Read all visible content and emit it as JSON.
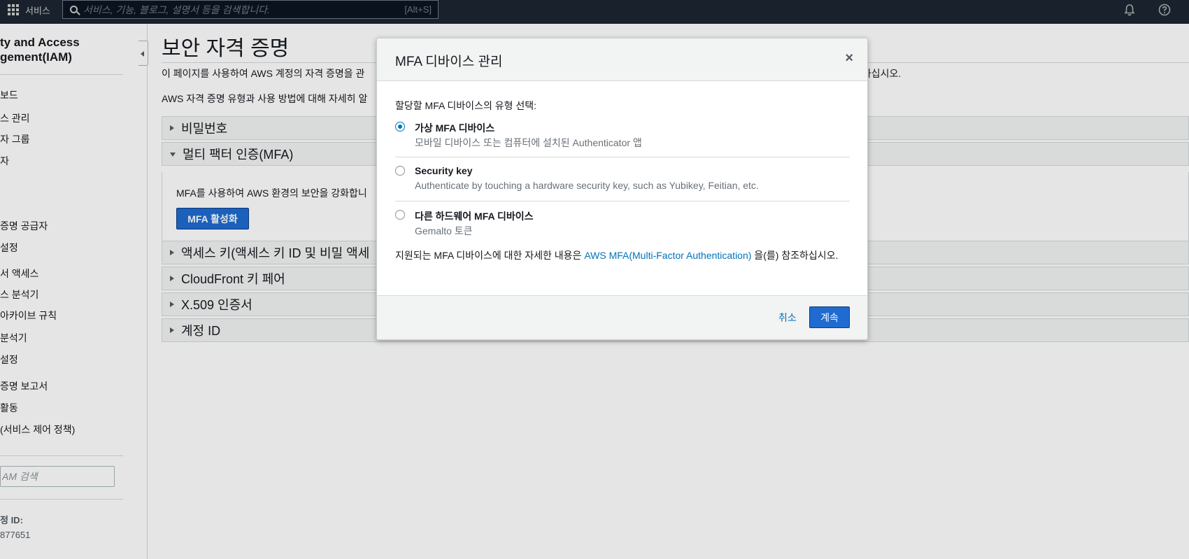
{
  "header": {
    "services_label": "서비스",
    "search_placeholder": "서비스, 기능, 블로그, 설명서 등을 검색합니다.",
    "search_shortcut": "[Alt+S]"
  },
  "sidebar": {
    "title_line1": "ty and Access",
    "title_line2": "gement(IAM)",
    "items": [
      {
        "label": "보드"
      },
      {
        "label": "스 관리"
      },
      {
        "label": "자 그룹"
      },
      {
        "label": "자"
      },
      {
        "label": ""
      },
      {
        "label": ""
      },
      {
        "label": "증명 공급자"
      },
      {
        "label": "설정"
      },
      {
        "label": "서 액세스"
      },
      {
        "label": "스 분석기"
      },
      {
        "label": "아카이브 규칙"
      },
      {
        "label": "분석기"
      },
      {
        "label": "설정"
      },
      {
        "label": "증명 보고서"
      },
      {
        "label": "활동"
      },
      {
        "label": "(서비스 제어 정책)"
      }
    ],
    "search_placeholder": "AM 검색",
    "account_id_label": "정 ID:",
    "account_id_value": "877651"
  },
  "main": {
    "title": "보안 자격 증명",
    "intro1": "이 페이지를 사용하여 AWS 계정의 자격 증명을 관",
    "intro1_tail": "용하십시오.",
    "intro2": "AWS 자격 증명 유형과 사용 방법에 대해 자세히 알",
    "sections": [
      {
        "label": "비밀번호"
      },
      {
        "label": "멀티 팩터 인증(MFA)"
      },
      {
        "label": "액세스 키(액세스 키 ID 및 비밀 액세"
      },
      {
        "label": "CloudFront 키 페어"
      },
      {
        "label": "X.509 인증서"
      },
      {
        "label": "계정 ID"
      }
    ],
    "mfa_text": "MFA를 사용하여 AWS 환경의 보안을 강화합니",
    "mfa_button": "MFA 활성화"
  },
  "modal": {
    "title": "MFA 디바이스 관리",
    "close": "×",
    "prompt": "할당할 MFA 디바이스의 유형 선택:",
    "options": [
      {
        "title": "가상 MFA 디바이스",
        "desc": "모바일 디바이스 또는 컴퓨터에 설치된 Authenticator 앱",
        "selected": true
      },
      {
        "title": "Security key",
        "desc": "Authenticate by touching a hardware security key, such as Yubikey, Feitian, etc.",
        "selected": false
      },
      {
        "title": "다른 하드웨어 MFA 디바이스",
        "desc": "Gemalto 토큰",
        "selected": false
      }
    ],
    "info_prefix": "지원되는 MFA 디바이스에 대한 자세한 내용은 ",
    "info_link": "AWS MFA(Multi-Factor Authentication)",
    "info_suffix": " 을(를) 참조하십시오.",
    "cancel": "취소",
    "continue": "계속"
  },
  "colors": {
    "topbar": "#232f3e",
    "primary": "#1f6bd1",
    "link": "#0073bb"
  }
}
